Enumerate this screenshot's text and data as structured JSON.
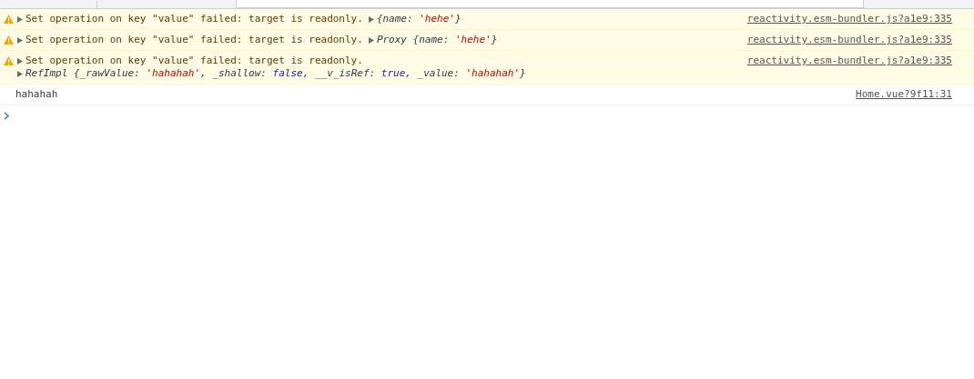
{
  "messages": [
    {
      "kind": "warning",
      "expanded": false,
      "text": "Set operation on key \"value\" failed: target is readonly.",
      "object": {
        "expanded": false,
        "tokens": [
          {
            "kind": "plain",
            "text": "{name: "
          },
          {
            "kind": "string",
            "text": "'hehe'"
          },
          {
            "kind": "plain",
            "text": "}"
          }
        ]
      },
      "source": "reactivity.esm-bundler.js?a1e9:335"
    },
    {
      "kind": "warning",
      "expanded": false,
      "text": "Set operation on key \"value\" failed: target is readonly.",
      "object": {
        "expanded": false,
        "tokens": [
          {
            "kind": "plain",
            "text": "Proxy {name: "
          },
          {
            "kind": "string",
            "text": "'hehe'"
          },
          {
            "kind": "plain",
            "text": "}"
          }
        ]
      },
      "source": "reactivity.esm-bundler.js?a1e9:335"
    },
    {
      "kind": "warning",
      "expanded": false,
      "text": "Set operation on key \"value\" failed: target is readonly.",
      "object": {
        "expanded": false,
        "tokens": [
          {
            "kind": "plain",
            "text": "RefImpl {_rawValue: "
          },
          {
            "kind": "string",
            "text": "'hahahah'"
          },
          {
            "kind": "plain",
            "text": ", _shallow: "
          },
          {
            "kind": "bool",
            "text": "false"
          },
          {
            "kind": "plain",
            "text": ", __v_isRef: "
          },
          {
            "kind": "bool",
            "text": "true"
          },
          {
            "kind": "plain",
            "text": ", _value: "
          },
          {
            "kind": "string",
            "text": "'hahahah'"
          },
          {
            "kind": "plain",
            "text": "}"
          }
        ]
      },
      "source": "reactivity.esm-bundler.js?a1e9:335"
    },
    {
      "kind": "log",
      "text": "hahahah",
      "source": "Home.vue?9f11:31"
    }
  ]
}
